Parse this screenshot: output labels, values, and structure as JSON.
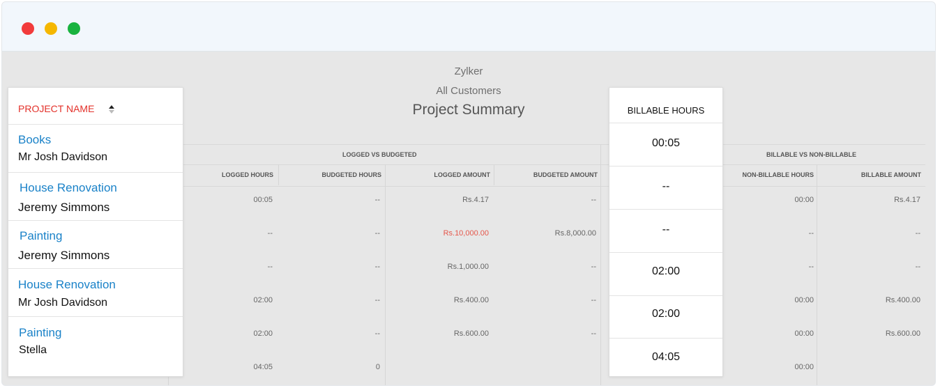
{
  "window_controls": [
    "close",
    "minimize",
    "maximize"
  ],
  "report": {
    "company": "Zylker",
    "customers": "All Customers",
    "title": "Project Summary",
    "group_headers": [
      "LOGGED VS BUDGETED",
      "BILLABLE VS NON-BILLABLE"
    ],
    "columns_left": [
      "LOGGED HOURS",
      "BUDGETED HOURS",
      "LOGGED AMOUNT",
      "BUDGETED AMOUNT"
    ],
    "columns_right": [
      "NON-BILLABLE HOURS",
      "BILLABLE AMOUNT"
    ],
    "rows": [
      {
        "logged_hours": "00:05",
        "budgeted_hours": "--",
        "logged_amount": "Rs.4.17",
        "budgeted_amount": "--",
        "non_billable_hours": "00:00",
        "billable_amount": "Rs.4.17"
      },
      {
        "logged_hours": "--",
        "budgeted_hours": "--",
        "logged_amount": "Rs.10,000.00",
        "budgeted_amount": "Rs.8,000.00",
        "non_billable_hours": "--",
        "billable_amount": "--"
      },
      {
        "logged_hours": "--",
        "budgeted_hours": "--",
        "logged_amount": "Rs.1,000.00",
        "budgeted_amount": "--",
        "non_billable_hours": "--",
        "billable_amount": "--"
      },
      {
        "logged_hours": "02:00",
        "budgeted_hours": "--",
        "logged_amount": "Rs.400.00",
        "budgeted_amount": "--",
        "non_billable_hours": "00:00",
        "billable_amount": "Rs.400.00"
      },
      {
        "logged_hours": "02:00",
        "budgeted_hours": "--",
        "logged_amount": "Rs.600.00",
        "budgeted_amount": "--",
        "non_billable_hours": "00:00",
        "billable_amount": "Rs.600.00"
      }
    ],
    "totals": {
      "logged_hours": "04:05",
      "budgeted_hours": "0",
      "non_billable_hours": "00:00"
    }
  },
  "project_panel": {
    "header": "PROJECT NAME",
    "rows": [
      {
        "project": "Books",
        "customer": "Mr Josh Davidson"
      },
      {
        "project": "House Renovation",
        "customer": "Jeremy Simmons"
      },
      {
        "project": "Painting",
        "customer": "Jeremy Simmons"
      },
      {
        "project": "House Renovation",
        "customer": "Mr Josh Davidson"
      },
      {
        "project": "Painting",
        "customer": "Stella"
      }
    ]
  },
  "billable_panel": {
    "header": "BILLABLE HOURS",
    "values": [
      "00:05",
      "--",
      "--",
      "02:00",
      "02:00",
      "04:05"
    ]
  },
  "colors": {
    "accent_red": "#e3312a",
    "link_blue": "#1a82c8",
    "overdue_red": "#e5574b",
    "close": "#f23b3b",
    "minimize": "#f5b700",
    "maximize": "#19b33f"
  }
}
